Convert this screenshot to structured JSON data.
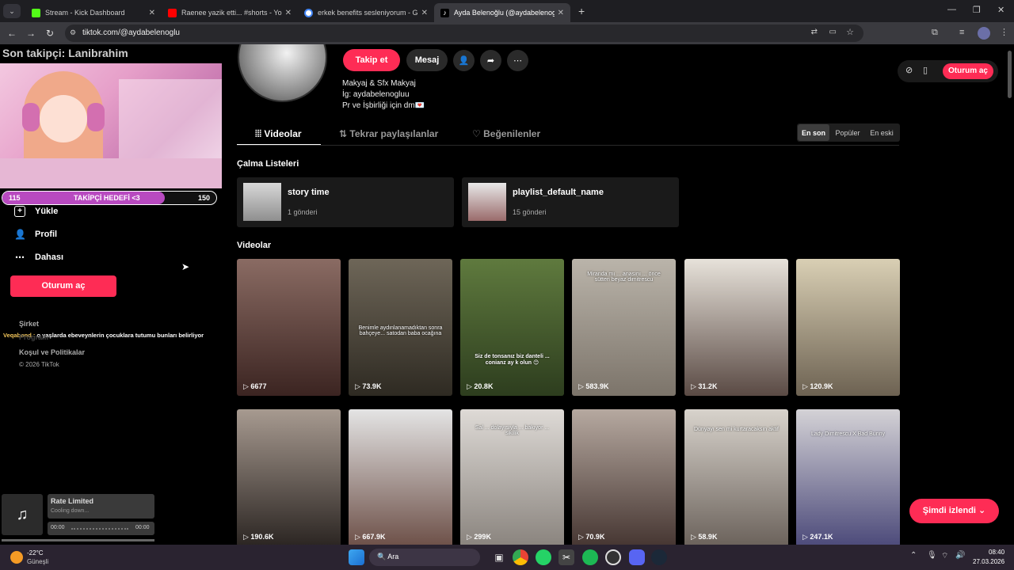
{
  "browser": {
    "tabs": [
      {
        "title": "Stream - Kick Dashboard",
        "color": "#53fc18"
      },
      {
        "title": "Raenee yazik etti... #shorts - Yo",
        "color": "#ff0000"
      },
      {
        "title": "erkek benefits sesleniyorum - G",
        "color": "#4285f4"
      },
      {
        "title": "Ayda Belenoğlu (@aydabelenog",
        "color": "#000000"
      }
    ],
    "url": "tiktok.com/@aydabelenoglu"
  },
  "overlay": {
    "follower_title": "Son takipçi: Lanibrahim",
    "goal_label": "TAKİPÇİ HEDEFİ <3",
    "goal_current": "115",
    "goal_target": "150",
    "goal_progress": 0.76,
    "chat_name": "Veqabond :",
    "chat_message": "o yaşlarda ebeveynlerin çocuklara tutumu bunları belirliyor"
  },
  "sidebar": {
    "items": [
      {
        "label": "Yükle",
        "icon": "upload-icon"
      },
      {
        "label": "Profil",
        "icon": "user-icon"
      },
      {
        "label": "Dahası",
        "icon": "more-icon"
      }
    ],
    "login": "Oturum aç",
    "company": "Şirket",
    "program": "Program",
    "terms": "Koşul ve Politikalar",
    "copyright": "© 2026 TikTok"
  },
  "player": {
    "title": "Rate Limited",
    "subtitle": "Cooling down...",
    "time_start": "00:00",
    "time_end": "00:00"
  },
  "profile": {
    "follow": "Takip et",
    "message": "Mesaj",
    "bio": [
      "Makyaj & Sfx Makyaj",
      "İg: aydabelenogluu",
      "Pr ve İşbirliği için dm💌"
    ],
    "login": "Oturum aç",
    "tabs": [
      "Videolar",
      "Tekrar paylaşılanlar",
      "Beğenilenler"
    ],
    "sort": [
      "En son",
      "Popüler",
      "En eski"
    ],
    "playlists_title": "Çalma Listeleri",
    "playlists": [
      {
        "name": "story time",
        "count": "1 gönderi"
      },
      {
        "name": "playlist_default_name",
        "count": "15 gönderi"
      }
    ],
    "videos_title": "Videolar",
    "videos": [
      {
        "views": "6677",
        "caption": ""
      },
      {
        "views": "73.9K",
        "caption": "Benimle aydınlanamadıktan sonra bahçeye... satodan baba ocağına"
      },
      {
        "views": "20.8K",
        "caption": "Siz de tonsanız biz danteli ... conianz ay k olun 😊"
      },
      {
        "views": "583.9K",
        "caption": "Miranda mı ... anasını ... önce sütten beyaz dimitrescu"
      },
      {
        "views": "31.2K",
        "caption": ""
      },
      {
        "views": "120.9K",
        "caption": ""
      },
      {
        "views": "190.6K",
        "caption": ""
      },
      {
        "views": "667.9K",
        "caption": ""
      },
      {
        "views": "299K",
        "caption": "Sal ... dolayısıyla ... bakıyor ... sikilik"
      },
      {
        "views": "70.9K",
        "caption": ""
      },
      {
        "views": "58.9K",
        "caption": "Dünyayı sen mi kurtaracaksın aktif"
      },
      {
        "views": "247.1K",
        "caption": "Lady Dimitrescu X Bad Bunny"
      }
    ],
    "watched_now": "Şimdi izlendi"
  },
  "taskbar": {
    "temp": "-22°C",
    "weather": "Güneşli",
    "search": "Ara",
    "time": "08:40",
    "date": "27.03.2026"
  },
  "colors": {
    "accent": "#fe2c55",
    "overlay_bar": "#b84ac0"
  }
}
